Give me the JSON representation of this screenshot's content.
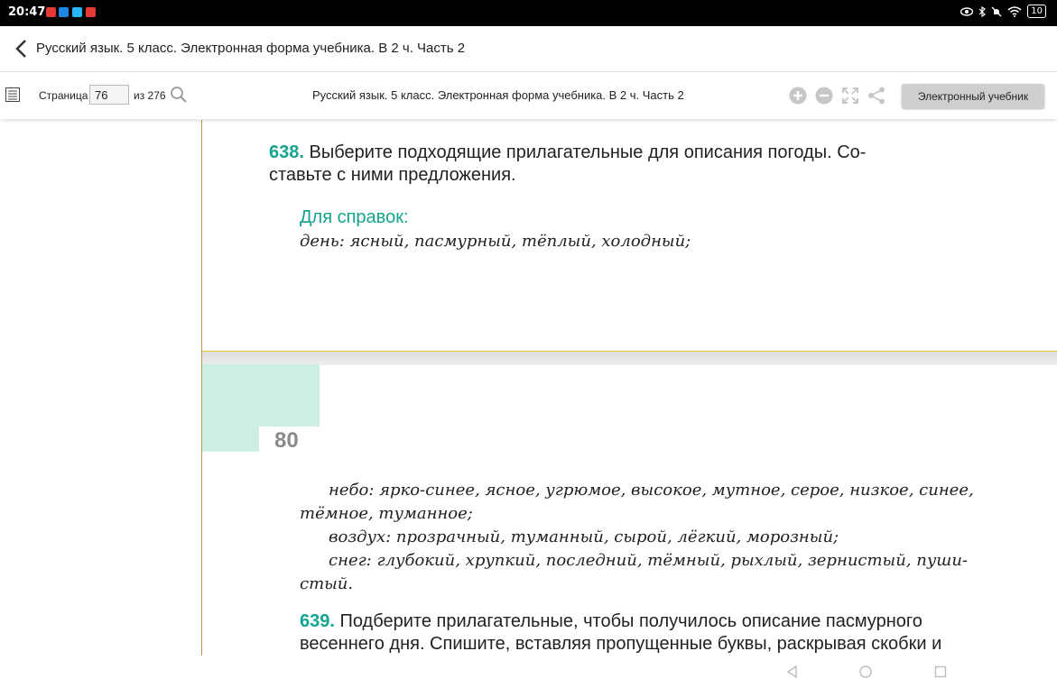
{
  "status_bar": {
    "time": "20:47",
    "battery": "10"
  },
  "app_bar": {
    "title": "Русский язык. 5 класс. Электронная форма учебника. В 2 ч. Часть 2"
  },
  "toolbar": {
    "page_label": "Страница",
    "page_value": "76",
    "total_label": "из 276",
    "book_title": "Русский язык. 5 класс. Электронная форма учебника. В 2 ч. Часть 2",
    "ebook_button": "Электронный учебник"
  },
  "content": {
    "ex638": {
      "number": "638.",
      "text_line1": "Выберите подходящие прилагательные для описания погоды. Со-",
      "text_line2": "ставьте с ними предложения."
    },
    "reference_title": "Для справок:",
    "ref_line1": "день: ясный, пасмурный, тёплый, холодный;",
    "page_number": "80",
    "ref_line2": "небо: ярко-синее, ясное, угрюмое, высокое, мутное, серое, низкое, синее,",
    "ref_line3": "тёмное, туманное;",
    "ref_line4": "воздух: прозрачный, туманный, сырой, лёгкий, морозный;",
    "ref_line5": "снег: глубокий, хрупкий, последний, тёмный, рыхлый, зернистый, пуши-",
    "ref_line6": "стый.",
    "ex639": {
      "number": "639.",
      "text_line1": "Подберите прилагательные, чтобы получилось описание пасмурного",
      "text_line2": "весеннего дня. Спишите, вставляя пропущенные буквы, раскрывая скобки и"
    }
  },
  "colors": {
    "accent_teal": "#13a38f",
    "teal_block": "#cdeee5",
    "button_gray": "#cfcfcf"
  }
}
